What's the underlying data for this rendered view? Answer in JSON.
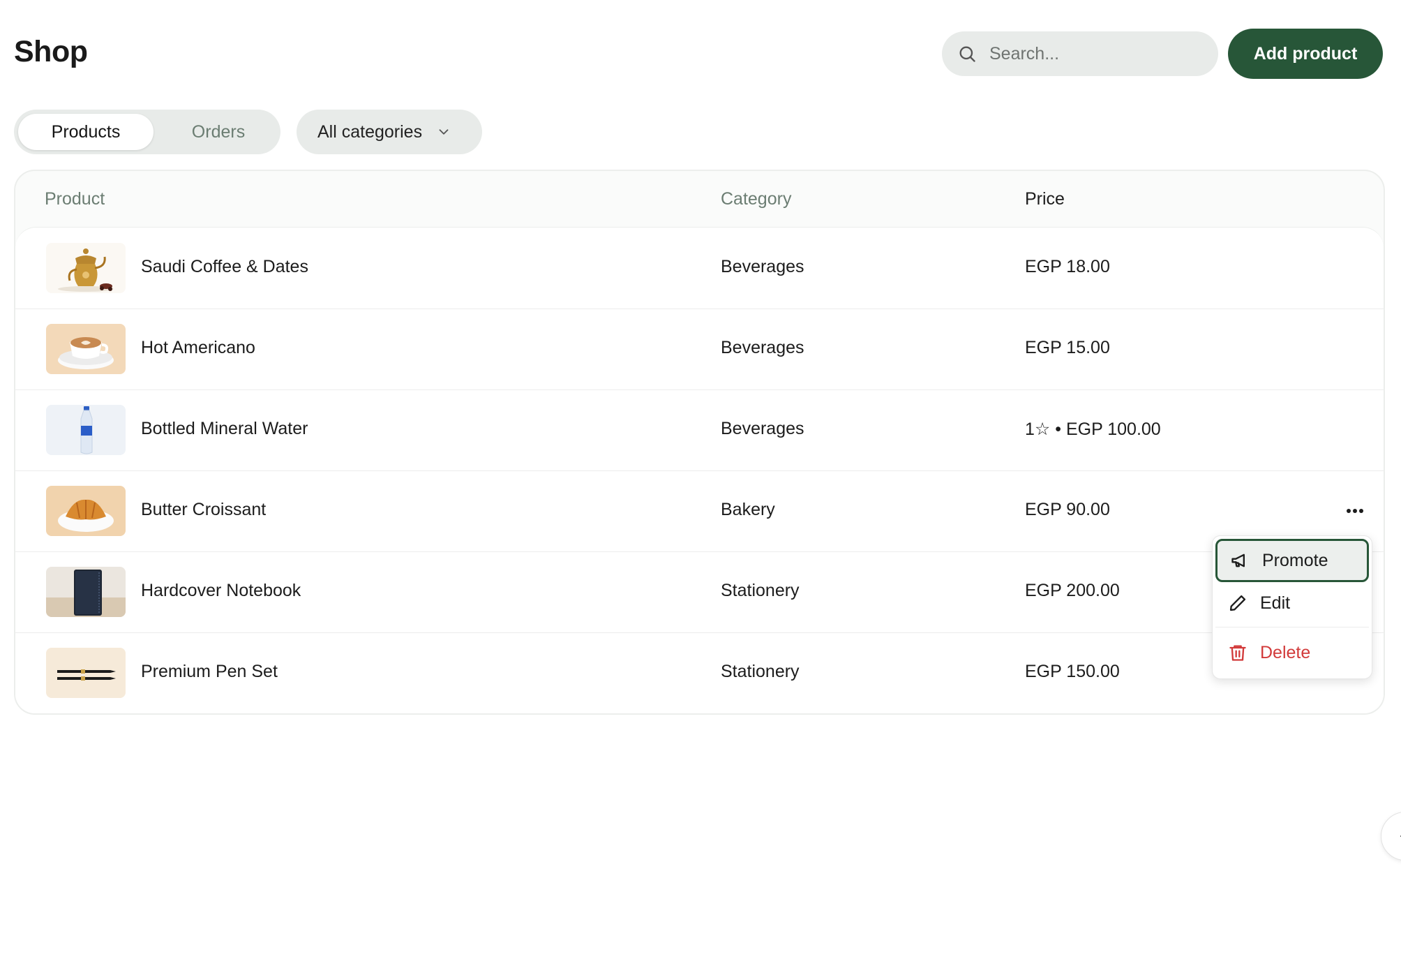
{
  "header": {
    "title": "Shop",
    "search_placeholder": "Search...",
    "add_button": "Add product"
  },
  "tabs": [
    {
      "label": "Products",
      "active": true
    },
    {
      "label": "Orders",
      "active": false
    }
  ],
  "category_filter": {
    "selected": "All categories"
  },
  "table": {
    "columns": [
      "Product",
      "Category",
      "Price"
    ],
    "rows": [
      {
        "name": "Saudi Coffee & Dates",
        "category": "Beverages",
        "price": "EGP 18.00",
        "image": "coffee-pot-image"
      },
      {
        "name": "Hot Americano",
        "category": "Beverages",
        "price": "EGP 15.00",
        "image": "latte-cup-image"
      },
      {
        "name": "Bottled Mineral Water",
        "category": "Beverages",
        "price": "1☆ • EGP 100.00",
        "image": "water-bottle-image"
      },
      {
        "name": "Butter Croissant",
        "category": "Bakery",
        "price": "EGP 90.00",
        "image": "croissant-image"
      },
      {
        "name": "Hardcover Notebook",
        "category": "Stationery",
        "price": "EGP 200.00",
        "image": "notebook-image"
      },
      {
        "name": "Premium Pen Set",
        "category": "Stationery",
        "price": "EGP 150.00",
        "image": "pen-set-image"
      }
    ]
  },
  "context_menu": {
    "promote": "Promote",
    "edit": "Edit",
    "delete": "Delete"
  },
  "colors": {
    "accent": "#275638",
    "danger": "#d23a3a",
    "muted_text": "#6b7d72",
    "pill_bg": "#e8ebe9"
  }
}
